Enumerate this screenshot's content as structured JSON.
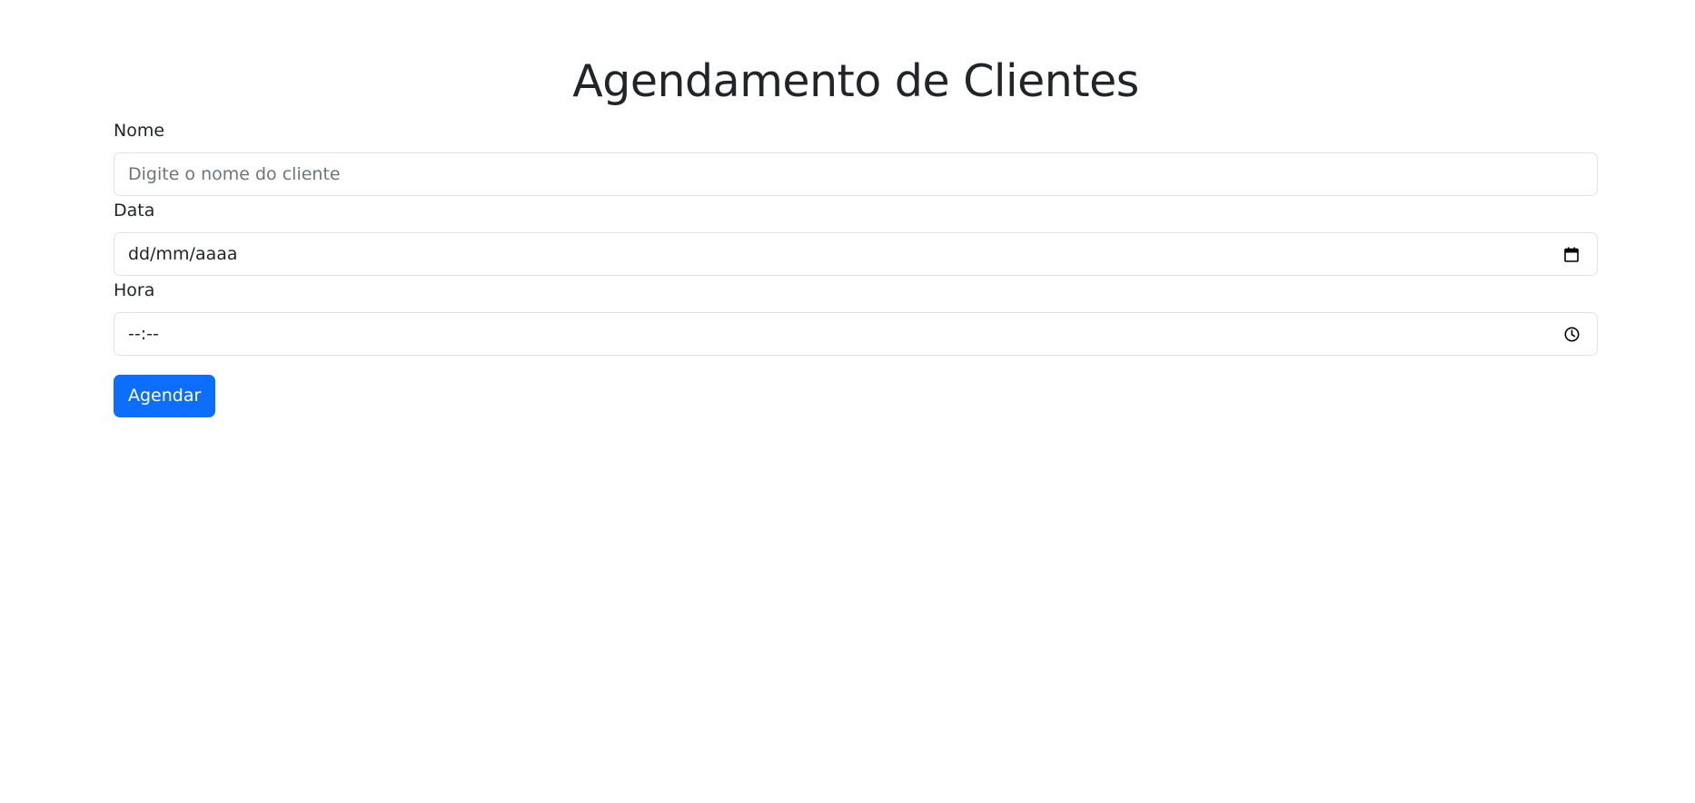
{
  "page": {
    "title": "Agendamento de Clientes"
  },
  "form": {
    "nome": {
      "label": "Nome",
      "placeholder": "Digite o nome do cliente"
    },
    "data": {
      "label": "Data",
      "value": "dd/mm/aaaa",
      "icon": "calendar-icon"
    },
    "hora": {
      "label": "Hora",
      "value": "--:--",
      "icon": "clock-icon"
    },
    "submit_label": "Agendar"
  },
  "colors": {
    "primary": "#0d6efd",
    "text": "#212529",
    "placeholder": "#6c757d",
    "border": "#dee2e6"
  }
}
